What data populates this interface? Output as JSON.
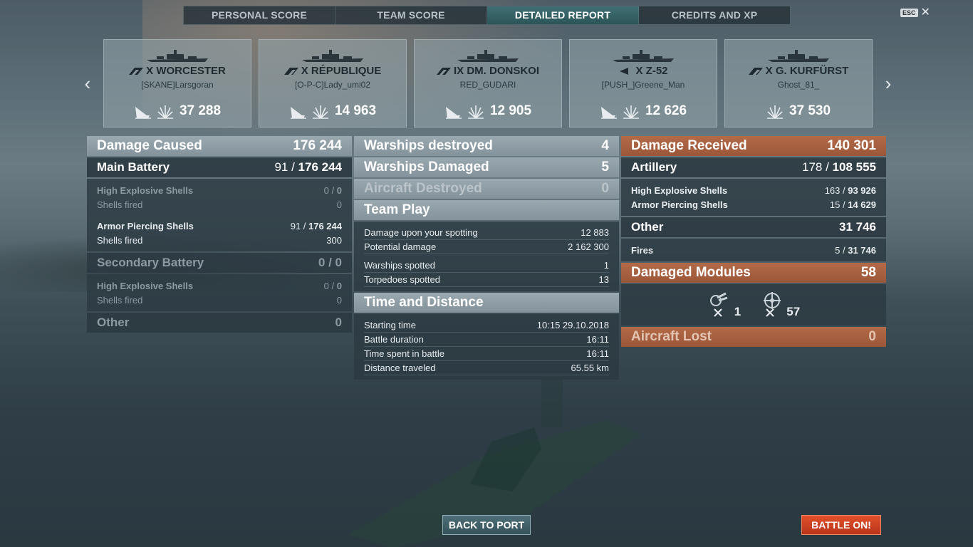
{
  "tabs": [
    "PERSONAL SCORE",
    "TEAM SCORE",
    "DETAILED REPORT",
    "CREDITS AND XP"
  ],
  "active_tab": 2,
  "esc_label": "ESC",
  "close_glyph": "✕",
  "arrows": {
    "left": "‹",
    "right": "›"
  },
  "ships": [
    {
      "name": "X WORCESTER",
      "player": "[SKANE]Larsgoran",
      "damage": "37 288",
      "class_icon": "cruiser-icon",
      "has_kill_icon": true
    },
    {
      "name": "X RÉPUBLIQUE",
      "player": "[O-P-C]Lady_umi02",
      "damage": "14 963",
      "class_icon": "battleship-icon",
      "has_kill_icon": true
    },
    {
      "name": "IX DM. DONSKOI",
      "player": "RED_GUDARI",
      "damage": "12 905",
      "class_icon": "cruiser-icon",
      "has_kill_icon": true
    },
    {
      "name": "X Z-52",
      "player": "[PUSH_]Greene_Man",
      "damage": "12 626",
      "class_icon": "destroyer-icon",
      "has_kill_icon": true
    },
    {
      "name": "X G. KURFÜRST",
      "player": "Ghost_81_",
      "damage": "37 530",
      "class_icon": "battleship-icon",
      "has_kill_icon": false
    }
  ],
  "damage_caused": {
    "label": "Damage Caused",
    "value": "176 244",
    "main_battery": {
      "label": "Main Battery",
      "hits": "91 /",
      "value": "176 244"
    },
    "mb_he": {
      "label": "High Explosive Shells",
      "hits": "0 /",
      "value": "0"
    },
    "mb_he_fired": {
      "label": "Shells fired",
      "value": "0"
    },
    "mb_ap": {
      "label": "Armor Piercing Shells",
      "hits": "91 /",
      "value": "176 244"
    },
    "mb_ap_fired": {
      "label": "Shells fired",
      "value": "300"
    },
    "secondary": {
      "label": "Secondary Battery",
      "value": "0 / 0"
    },
    "sec_he": {
      "label": "High Explosive Shells",
      "hits": "0 /",
      "value": "0"
    },
    "sec_fired": {
      "label": "Shells fired",
      "value": "0"
    },
    "other": {
      "label": "Other",
      "value": "0"
    }
  },
  "middle": {
    "destroyed": {
      "label": "Warships destroyed",
      "value": "4"
    },
    "damaged": {
      "label": "Warships Damaged",
      "value": "5"
    },
    "aircraft": {
      "label": "Aircraft Destroyed",
      "value": "0"
    },
    "team_play": "Team Play",
    "spotting_damage": {
      "label": "Damage upon your spotting",
      "value": "12 883"
    },
    "potential": {
      "label": "Potential damage",
      "value": "2 162 300"
    },
    "ships_spotted": {
      "label": "Warships spotted",
      "value": "1"
    },
    "torps_spotted": {
      "label": "Torpedoes spotted",
      "value": "13"
    },
    "time_distance": "Time and Distance",
    "start": {
      "label": "Starting time",
      "value": "10:15  29.10.2018"
    },
    "duration": {
      "label": "Battle duration",
      "value": "16:11"
    },
    "time_spent": {
      "label": "Time spent in battle",
      "value": "16:11"
    },
    "distance": {
      "label": "Distance traveled",
      "value": "65.55 km"
    }
  },
  "damage_received": {
    "label": "Damage Received",
    "value": "140 301",
    "artillery": {
      "label": "Artillery",
      "hits": "178 /",
      "value": "108 555"
    },
    "he": {
      "label": "High Explosive Shells",
      "hits": "163 /",
      "value": "93 926"
    },
    "ap": {
      "label": "Armor Piercing Shells",
      "hits": "15 /",
      "value": "14 629"
    },
    "other": {
      "label": "Other",
      "value": "31 746"
    },
    "fires": {
      "label": "Fires",
      "hits": "5 /",
      "value": "31 746"
    },
    "modules": {
      "label": "Damaged Modules",
      "value": "58",
      "gun_count": "1",
      "steering_count": "57"
    },
    "aircraft_lost": {
      "label": "Aircraft Lost",
      "value": "0"
    }
  },
  "buttons": {
    "back": "BACK TO PORT",
    "battle": "BATTLE ON!"
  }
}
